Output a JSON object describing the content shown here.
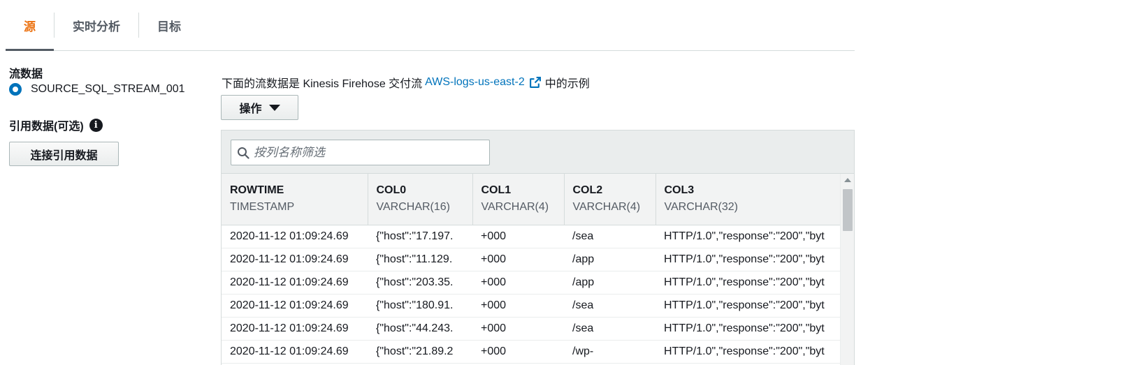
{
  "tabs": [
    {
      "label": "源",
      "active": true
    },
    {
      "label": "实时分析",
      "active": false
    },
    {
      "label": "目标",
      "active": false
    }
  ],
  "left": {
    "stream_label": "流数据",
    "stream_option": "SOURCE_SQL_STREAM_001",
    "reference_label": "引用数据(可选)",
    "connect_button": "连接引用数据"
  },
  "main": {
    "desc_prefix": "下面的流数据是 Kinesis Firehose 交付流",
    "desc_link": "AWS-logs-us-east-2",
    "desc_suffix": "中的示例",
    "actions_button": "操作",
    "filter_placeholder": "按列名称筛选"
  },
  "table": {
    "columns": [
      {
        "name": "ROWTIME",
        "type": "TIMESTAMP"
      },
      {
        "name": "COL0",
        "type": "VARCHAR(16)"
      },
      {
        "name": "COL1",
        "type": "VARCHAR(4)"
      },
      {
        "name": "COL2",
        "type": "VARCHAR(4)"
      },
      {
        "name": "COL3",
        "type": "VARCHAR(32)"
      }
    ],
    "rows": [
      [
        "2020-11-12 01:09:24.69",
        "{\"host\":\"17.197.",
        "+000",
        "/sea",
        "HTTP/1.0\",\"response\":\"200\",\"byt"
      ],
      [
        "2020-11-12 01:09:24.69",
        "{\"host\":\"11.129.",
        "+000",
        "/app",
        "HTTP/1.0\",\"response\":\"200\",\"byt"
      ],
      [
        "2020-11-12 01:09:24.69",
        "{\"host\":\"203.35.",
        "+000",
        "/app",
        "HTTP/1.0\",\"response\":\"200\",\"byt"
      ],
      [
        "2020-11-12 01:09:24.69",
        "{\"host\":\"180.91.",
        "+000",
        "/sea",
        "HTTP/1.0\",\"response\":\"200\",\"byt"
      ],
      [
        "2020-11-12 01:09:24.69",
        "{\"host\":\"44.243.",
        "+000",
        "/sea",
        "HTTP/1.0\",\"response\":\"200\",\"byt"
      ],
      [
        "2020-11-12 01:09:24.69",
        "{\"host\":\"21.89.2",
        "+000",
        "/wp-",
        "HTTP/1.0\",\"response\":\"200\",\"byt"
      ]
    ]
  },
  "colors": {
    "accent": "#ec7211",
    "link": "#0073bb",
    "text": "#16191f",
    "muted": "#545b64"
  }
}
